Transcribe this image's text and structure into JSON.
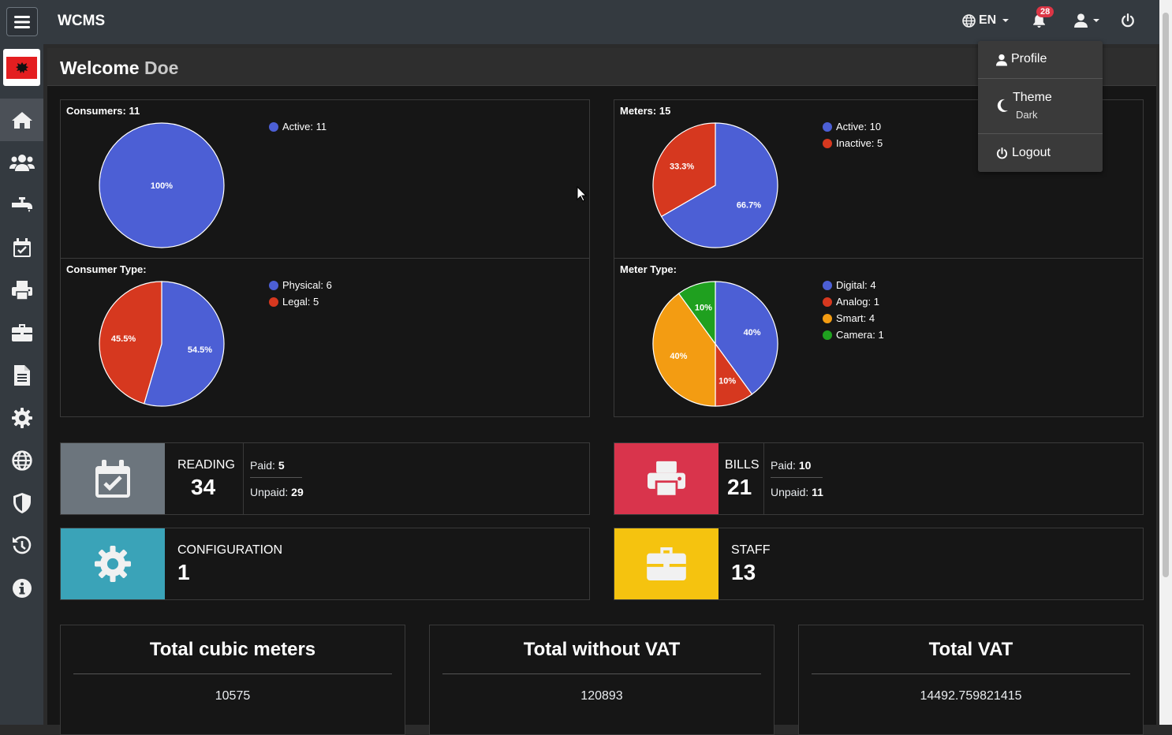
{
  "app": {
    "brand": "WCMS"
  },
  "topbar": {
    "language": "EN",
    "notifications_count": "28"
  },
  "welcome": {
    "prefix": "Welcome",
    "name": "Doe"
  },
  "user_menu": {
    "profile": "Profile",
    "theme_label": "Theme",
    "theme_value": "Dark",
    "logout": "Logout"
  },
  "sidebar": {
    "items": [
      "home-icon",
      "users-icon",
      "faucet-icon",
      "calendar-check-icon",
      "printer-icon",
      "briefcase-icon",
      "document-icon",
      "gear-icon",
      "globe-icon",
      "shield-icon",
      "history-icon",
      "info-icon"
    ]
  },
  "colors": {
    "blue": "#4c5fd5",
    "red": "#d6381f",
    "orange": "#f39c12",
    "green": "#1fa01f",
    "reading": "#6c757d",
    "bills": "#dc3545",
    "configuration": "#3aa3b8",
    "staff": "#f5c30f"
  },
  "chart_data": [
    {
      "type": "pie",
      "title": "Consumers: 11",
      "slices": [
        {
          "name": "Active",
          "value": 11,
          "label": "100%"
        }
      ],
      "legend": [
        "Active: 11"
      ]
    },
    {
      "type": "pie",
      "title": "Meters: 15",
      "slices": [
        {
          "name": "Active",
          "value": 10,
          "label": "66.7%"
        },
        {
          "name": "Inactive",
          "value": 5,
          "label": "33.3%"
        }
      ],
      "legend": [
        "Active: 10",
        "Inactive: 5"
      ]
    },
    {
      "type": "pie",
      "title": "Consumer Type:",
      "slices": [
        {
          "name": "Physical",
          "value": 6,
          "label": "54.5%"
        },
        {
          "name": "Legal",
          "value": 5,
          "label": "45.5%"
        }
      ],
      "legend": [
        "Physical: 6",
        "Legal: 5"
      ]
    },
    {
      "type": "pie",
      "title": "Meter Type:",
      "slices": [
        {
          "name": "Digital",
          "value": 4,
          "label": "40%"
        },
        {
          "name": "Analog",
          "value": 1,
          "label": "10%"
        },
        {
          "name": "Smart",
          "value": 4,
          "label": "40%"
        },
        {
          "name": "Camera",
          "value": 1,
          "label": "10%"
        }
      ],
      "legend": [
        "Digital: 4",
        "Analog: 1",
        "Smart: 4",
        "Camera: 1"
      ]
    }
  ],
  "stats": {
    "reading": {
      "label": "READING",
      "value": "34",
      "paid_label": "Paid:",
      "paid": "5",
      "unpaid_label": "Unpaid:",
      "unpaid": "29"
    },
    "bills": {
      "label": "BILLS",
      "value": "21",
      "paid_label": "Paid:",
      "paid": "10",
      "unpaid_label": "Unpaid:",
      "unpaid": "11"
    },
    "configuration": {
      "label": "CONFIGURATION",
      "value": "1"
    },
    "staff": {
      "label": "STAFF",
      "value": "13"
    }
  },
  "totals": [
    {
      "title": "Total cubic meters",
      "value": "10575"
    },
    {
      "title": "Total without VAT",
      "value": "120893"
    },
    {
      "title": "Total VAT",
      "value": "14492.759821415"
    }
  ]
}
